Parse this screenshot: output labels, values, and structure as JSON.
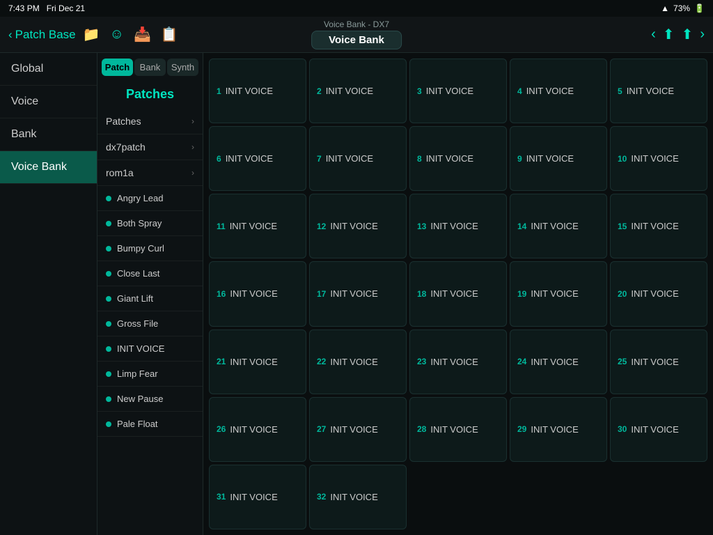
{
  "statusBar": {
    "time": "7:43 PM",
    "date": "Fri Dec 21",
    "wifi": "WiFi",
    "battery": "73%"
  },
  "topNav": {
    "backLabel": "Patch Base",
    "voiceBankSubtitle": "Voice Bank - DX7",
    "voiceBankTitle": "Voice Bank"
  },
  "sidebar": {
    "items": [
      {
        "id": "global",
        "label": "Global"
      },
      {
        "id": "voice",
        "label": "Voice"
      },
      {
        "id": "bank",
        "label": "Bank"
      },
      {
        "id": "voice-bank",
        "label": "Voice Bank",
        "active": true
      }
    ]
  },
  "tabs": [
    {
      "id": "patch",
      "label": "Patch",
      "active": true
    },
    {
      "id": "bank",
      "label": "Bank",
      "active": false
    },
    {
      "id": "synth",
      "label": "Synth",
      "active": false
    }
  ],
  "middlePanel": {
    "title": "Patches",
    "treeItems": [
      {
        "label": "Patches"
      },
      {
        "label": "dx7patch"
      },
      {
        "label": "rom1a"
      }
    ],
    "patchItems": [
      {
        "label": "Angry Lead"
      },
      {
        "label": "Both Spray"
      },
      {
        "label": "Bumpy Curl"
      },
      {
        "label": "Close Last"
      },
      {
        "label": "Giant Lift"
      },
      {
        "label": "Gross File"
      },
      {
        "label": "INIT VOICE"
      },
      {
        "label": "Limp Fear"
      },
      {
        "label": "New Pause"
      },
      {
        "label": "Pale Float"
      }
    ]
  },
  "voiceCells": [
    {
      "num": "1",
      "name": "INIT VOICE"
    },
    {
      "num": "2",
      "name": "INIT VOICE"
    },
    {
      "num": "3",
      "name": "INIT VOICE"
    },
    {
      "num": "4",
      "name": "INIT VOICE"
    },
    {
      "num": "5",
      "name": "INIT VOICE"
    },
    {
      "num": "6",
      "name": "INIT VOICE"
    },
    {
      "num": "7",
      "name": "INIT VOICE"
    },
    {
      "num": "8",
      "name": "INIT VOICE"
    },
    {
      "num": "9",
      "name": "INIT VOICE"
    },
    {
      "num": "10",
      "name": "INIT VOICE"
    },
    {
      "num": "11",
      "name": "INIT VOICE"
    },
    {
      "num": "12",
      "name": "INIT VOICE"
    },
    {
      "num": "13",
      "name": "INIT VOICE"
    },
    {
      "num": "14",
      "name": "INIT VOICE"
    },
    {
      "num": "15",
      "name": "INIT VOICE"
    },
    {
      "num": "16",
      "name": "INIT VOICE"
    },
    {
      "num": "17",
      "name": "INIT VOICE"
    },
    {
      "num": "18",
      "name": "INIT VOICE"
    },
    {
      "num": "19",
      "name": "INIT VOICE"
    },
    {
      "num": "20",
      "name": "INIT VOICE"
    },
    {
      "num": "21",
      "name": "INIT VOICE"
    },
    {
      "num": "22",
      "name": "INIT VOICE"
    },
    {
      "num": "23",
      "name": "INIT VOICE"
    },
    {
      "num": "24",
      "name": "INIT VOICE"
    },
    {
      "num": "25",
      "name": "INIT VOICE"
    },
    {
      "num": "26",
      "name": "INIT VOICE"
    },
    {
      "num": "27",
      "name": "INIT VOICE"
    },
    {
      "num": "28",
      "name": "INIT VOICE"
    },
    {
      "num": "29",
      "name": "INIT VOICE"
    },
    {
      "num": "30",
      "name": "INIT VOICE"
    },
    {
      "num": "31",
      "name": "INIT VOICE"
    },
    {
      "num": "32",
      "name": "INIT VOICE"
    },
    {
      "num": "",
      "name": "",
      "empty": true
    },
    {
      "num": "",
      "name": "",
      "empty": true
    },
    {
      "num": "",
      "name": "",
      "empty": true
    }
  ]
}
